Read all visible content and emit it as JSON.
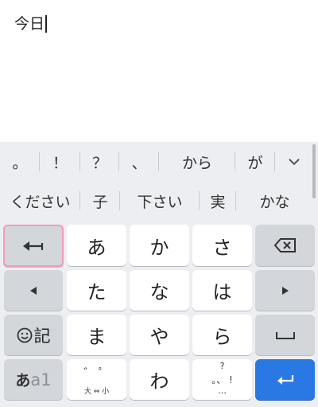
{
  "editor": {
    "text": "今日"
  },
  "candidates_row1": [
    "。",
    "！",
    "？",
    "、",
    "から",
    "が"
  ],
  "candidates_row2": [
    "ください",
    "子",
    "下さい",
    "実",
    "かな"
  ],
  "keys": {
    "row1": [
      "あ",
      "か",
      "さ"
    ],
    "row2": [
      "た",
      "な",
      "は"
    ],
    "row3": [
      "ま",
      "や",
      "ら"
    ],
    "row4": [
      "わ"
    ]
  },
  "special": {
    "kigou_label": "記",
    "mode_main": "あ",
    "mode_sub": "a1",
    "dakuten_top": "゛ ゜",
    "dakuten_bottom": "大 ⇔ 小",
    "punct_top": "?",
    "punct_mid": "。、 !",
    "punct_bottom": "…"
  },
  "icons": {
    "undo": "undo-arrow-icon",
    "backspace": "backspace-icon",
    "left": "cursor-left-icon",
    "right": "cursor-right-icon",
    "space": "space-icon",
    "enter": "enter-icon",
    "expand": "chevron-down-icon",
    "emoji": "smiley-icon"
  },
  "colors": {
    "accent": "#2a78e4",
    "highlight_border": "#f29bbd",
    "keyboard_bg": "#eceef2"
  }
}
